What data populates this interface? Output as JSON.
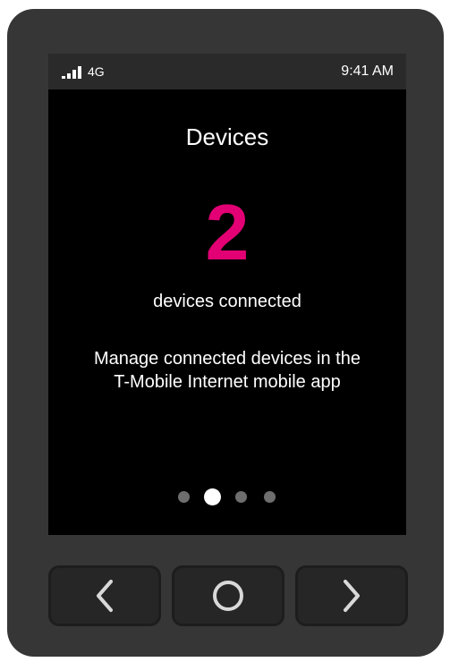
{
  "status_bar": {
    "network": "4G",
    "time": "9:41 AM",
    "signal_icon": "signal-bars-icon"
  },
  "main": {
    "title": "Devices",
    "count": "2",
    "count_label": "devices connected",
    "description": "Manage connected devices in the T-Mobile Internet mobile app"
  },
  "pager": {
    "pages": 4,
    "active_index": 1
  },
  "nav_buttons": {
    "back_icon": "chevron-left-icon",
    "home_icon": "circle-home-icon",
    "forward_icon": "chevron-right-icon"
  },
  "colors": {
    "accent": "#e20074",
    "bezel": "#363636",
    "screen": "#000000"
  }
}
